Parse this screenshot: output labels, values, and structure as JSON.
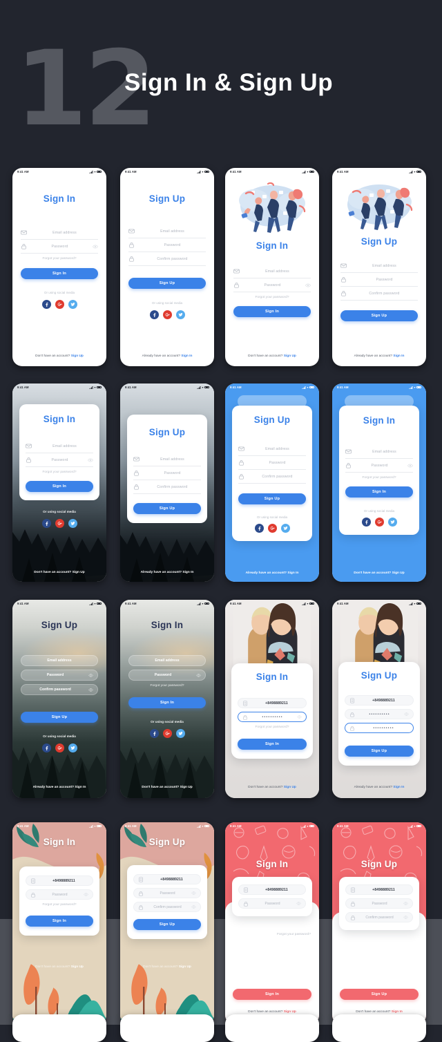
{
  "header": {
    "number": "12",
    "title": "Sign In & Sign Up"
  },
  "colors": {
    "background": "#22252e",
    "accent_blue": "#3b82e8",
    "accent_coral": "#f2696f",
    "facebook": "#2b4a8b",
    "google": "#e03b2f",
    "twitter": "#55acee",
    "number_gray": "#555860",
    "band_gray": "#4c4f57"
  },
  "statusbar": {
    "time": "9:41 AM"
  },
  "labels": {
    "sign_in": "Sign In",
    "sign_up": "Sign Up",
    "email": "Email address",
    "password": "Password",
    "confirm_password": "Confirm password",
    "phone": "+8498889211",
    "password_dots": "••••••••••",
    "forgot": "Forgot your password?",
    "or_social": "Or using social media",
    "no_account": "Don't have an account?",
    "have_account": "Already have an account?"
  },
  "socials": [
    {
      "name": "facebook",
      "glyph": "f"
    },
    {
      "name": "google-plus",
      "glyph": "G+"
    },
    {
      "name": "twitter",
      "glyph": "t"
    }
  ],
  "screens": [
    {
      "id": "s1",
      "variant": "white-signin",
      "title": "Sign In",
      "fields": [
        "Email address",
        "Password"
      ],
      "forgot": "Forgot your password?",
      "button": "Sign In",
      "or_social": "Or using social media",
      "footer_text": "Don't have an account?",
      "footer_link": "Sign Up"
    },
    {
      "id": "s2",
      "variant": "white-signup",
      "title": "Sign Up",
      "fields": [
        "Email address",
        "Password",
        "Confirm password"
      ],
      "button": "Sign Up",
      "or_social": "Or using social media",
      "footer_text": "Already have an account?",
      "footer_link": "Sign In"
    },
    {
      "id": "s3",
      "variant": "illustration-signin",
      "title": "Sign In",
      "fields": [
        "Email address",
        "Password"
      ],
      "forgot": "Forgot your password?",
      "button": "Sign In",
      "footer_text": "Don't have an account?",
      "footer_link": "Sign Up"
    },
    {
      "id": "s4",
      "variant": "illustration-signup",
      "title": "Sign Up",
      "fields": [
        "Email address",
        "Password",
        "Confirm password"
      ],
      "button": "Sign Up",
      "footer_text": "Already have an account?",
      "footer_link": "Sign In"
    },
    {
      "id": "s5",
      "variant": "photo-card-signin",
      "title": "Sign In",
      "fields": [
        "Email address",
        "Password"
      ],
      "forgot": "Forgot your password?",
      "button": "Sign In",
      "or_social": "Or using social media",
      "footer_text": "Don't have an account?",
      "footer_link": "Sign Up"
    },
    {
      "id": "s6",
      "variant": "photo-card-signup",
      "title": "Sign Up",
      "fields": [
        "Email address",
        "Password",
        "Confirm password"
      ],
      "button": "Sign Up",
      "footer_text": "Already have an account?",
      "footer_link": "Sign In"
    },
    {
      "id": "s7",
      "variant": "blue-card-signup",
      "title": "Sign Up",
      "fields": [
        "Email address",
        "Password",
        "Confirm password"
      ],
      "button": "Sign Up",
      "or_social": "Or using social media",
      "footer_text": "Already have an account?",
      "footer_link": "Sign In"
    },
    {
      "id": "s8",
      "variant": "blue-card-signin",
      "title": "Sign In",
      "fields": [
        "Email address",
        "Password"
      ],
      "forgot": "Forgot your password?",
      "button": "Sign In",
      "or_social": "Or using social media",
      "footer_text": "Don't have an account?",
      "footer_link": "Sign Up"
    },
    {
      "id": "s9",
      "variant": "forest-glass-signup",
      "title": "Sign Up",
      "fields": [
        "Email address",
        "Password",
        "Confirm password"
      ],
      "button": "Sign Up",
      "or_social": "Or using social media",
      "footer_text": "Already have an account?",
      "footer_link": "Sign In"
    },
    {
      "id": "s10",
      "variant": "forest-glass-signin",
      "title": "Sign In",
      "fields": [
        "Email address",
        "Password"
      ],
      "forgot": "Forgot your password?",
      "button": "Sign In",
      "or_social": "Or using social media",
      "footer_text": "Don't have an account?",
      "footer_link": "Sign Up"
    },
    {
      "id": "s11",
      "variant": "model-signin",
      "title": "Sign In",
      "fields": [
        "+8498889211",
        "••••••••••"
      ],
      "forgot": "Forgot your password?",
      "button": "Sign In",
      "footer_text": "Don't have an account?",
      "footer_link": "Sign Up"
    },
    {
      "id": "s12",
      "variant": "model-signup",
      "title": "Sign Up",
      "fields": [
        "+8498889211",
        "••••••••••",
        "••••••••••"
      ],
      "button": "Sign Up",
      "footer_text": "Already have an account?",
      "footer_link": "Sign In"
    },
    {
      "id": "s13",
      "variant": "illus-nature-signin",
      "title": "Sign In",
      "fields": [
        "+8498889211",
        "Password"
      ],
      "forgot": "Forgot your password?",
      "button": "Sign In",
      "footer_text": "Don't have an account?",
      "footer_link": "Sign Up"
    },
    {
      "id": "s14",
      "variant": "illus-nature-signup",
      "title": "Sign Up",
      "fields": [
        "+8498889211",
        "Password",
        "Confirm password"
      ],
      "button": "Sign Up",
      "footer_text": "Don't have an account?",
      "footer_link": "Sign Up"
    },
    {
      "id": "s15",
      "variant": "doodle-signin",
      "title": "Sign In",
      "fields": [
        "+8498889211",
        "Password"
      ],
      "forgot": "Forgot your password?",
      "button": "Sign In",
      "footer_text": "Don't have an account?",
      "footer_link": "Sign Up"
    },
    {
      "id": "s16",
      "variant": "doodle-signup",
      "title": "Sign Up",
      "fields": [
        "+8498889211",
        "Password",
        "Confirm password"
      ],
      "button": "Sign Up",
      "footer_text": "Don't have an account?",
      "footer_link": "Sign In"
    }
  ]
}
